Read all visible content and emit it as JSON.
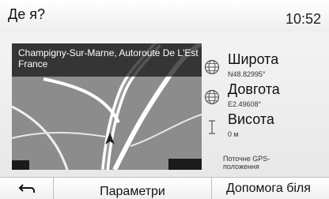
{
  "header": {
    "title": "Де я?",
    "time": "10:52"
  },
  "map": {
    "location_line1": "Champigny-Sur-Marne, Autoroute De L'Est",
    "location_line2": "France"
  },
  "info": {
    "latitude_label": "Широта",
    "latitude_value": "N48.82995°",
    "longitude_label": "Довгота",
    "longitude_value": "E2.49608°",
    "altitude_label": "Висота",
    "altitude_value": "0 м",
    "gps_note": "Поточне GPS-положення",
    "icons": [
      "globe-icon",
      "globe-icon",
      "altitude-icon"
    ]
  },
  "bottom_bar": {
    "back_icon": "back-arrow-icon",
    "parameters_label": "Параметри",
    "help_label": "Допомога біля"
  },
  "colors": {
    "map_road": "#ffffff",
    "map_bg": "#8a8a8a",
    "caption_bg": "#141414"
  }
}
